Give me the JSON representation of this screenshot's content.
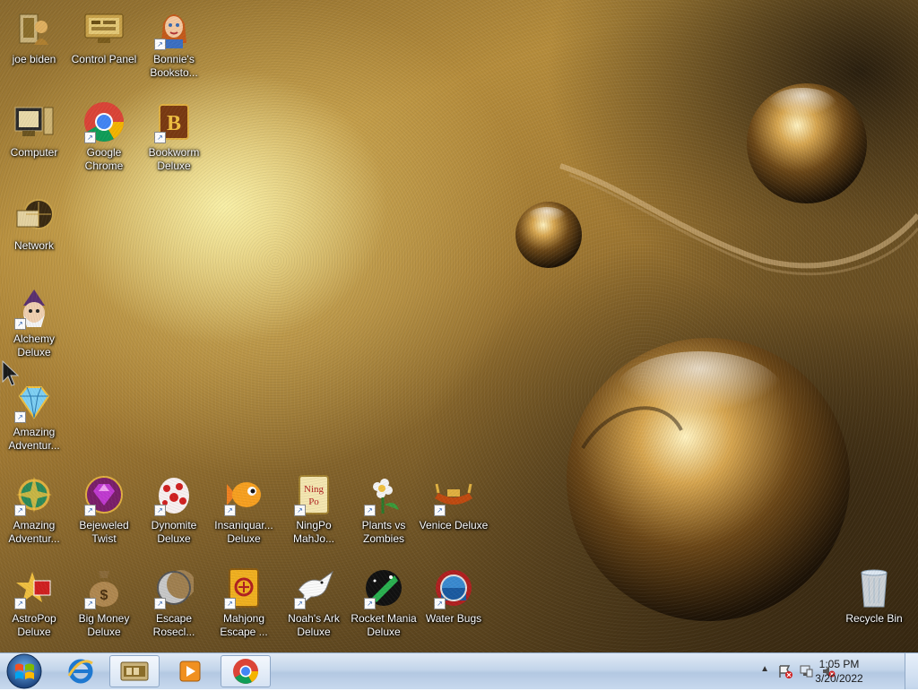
{
  "desktop": {
    "icons": [
      {
        "id": "joe-biden",
        "label": "joe biden"
      },
      {
        "id": "control-panel",
        "label": "Control Panel"
      },
      {
        "id": "bonnies-bookstore",
        "label": "Bonnie's Booksto..."
      },
      {
        "id": "computer",
        "label": "Computer"
      },
      {
        "id": "google-chrome",
        "label": "Google Chrome"
      },
      {
        "id": "bookworm-deluxe",
        "label": "Bookworm Deluxe"
      },
      {
        "id": "network",
        "label": "Network"
      },
      {
        "id": "alchemy-deluxe",
        "label": "Alchemy Deluxe"
      },
      {
        "id": "amazing-adventures-1",
        "label": "Amazing Adventur..."
      },
      {
        "id": "amazing-adventures-2",
        "label": "Amazing Adventur..."
      },
      {
        "id": "bejeweled-twist",
        "label": "Bejeweled Twist"
      },
      {
        "id": "dynomite-deluxe",
        "label": "Dynomite Deluxe"
      },
      {
        "id": "insaniquarium",
        "label": "Insaniquar... Deluxe"
      },
      {
        "id": "ningpo-mahjong",
        "label": "NingPo MahJo..."
      },
      {
        "id": "plants-vs-zombies",
        "label": "Plants vs Zombies"
      },
      {
        "id": "venice-deluxe",
        "label": "Venice Deluxe"
      },
      {
        "id": "astropop-deluxe",
        "label": "AstroPop Deluxe"
      },
      {
        "id": "big-money-deluxe",
        "label": "Big Money Deluxe"
      },
      {
        "id": "escape-rosecliff",
        "label": "Escape Rosecl..."
      },
      {
        "id": "mahjong-escape",
        "label": "Mahjong Escape ..."
      },
      {
        "id": "noahs-ark-deluxe",
        "label": "Noah's Ark Deluxe"
      },
      {
        "id": "rocket-mania-deluxe",
        "label": "Rocket Mania Deluxe"
      },
      {
        "id": "water-bugs",
        "label": "Water Bugs"
      },
      {
        "id": "recycle-bin",
        "label": "Recycle Bin"
      }
    ]
  },
  "taskbar": {
    "pinned": [
      {
        "id": "start",
        "icon": "windows-logo-icon"
      },
      {
        "id": "internet-explorer",
        "icon": "internet-explorer-icon"
      },
      {
        "id": "file-explorer",
        "icon": "folder-icon"
      },
      {
        "id": "media-player",
        "icon": "media-player-icon"
      },
      {
        "id": "google-chrome",
        "icon": "chrome-icon"
      }
    ],
    "tray": {
      "show_hidden": "▲",
      "time": "1:05 PM",
      "date": "3/20/2022"
    }
  },
  "colors": {
    "taskbar": "#c3d5ea",
    "label_text": "#ffffff"
  }
}
